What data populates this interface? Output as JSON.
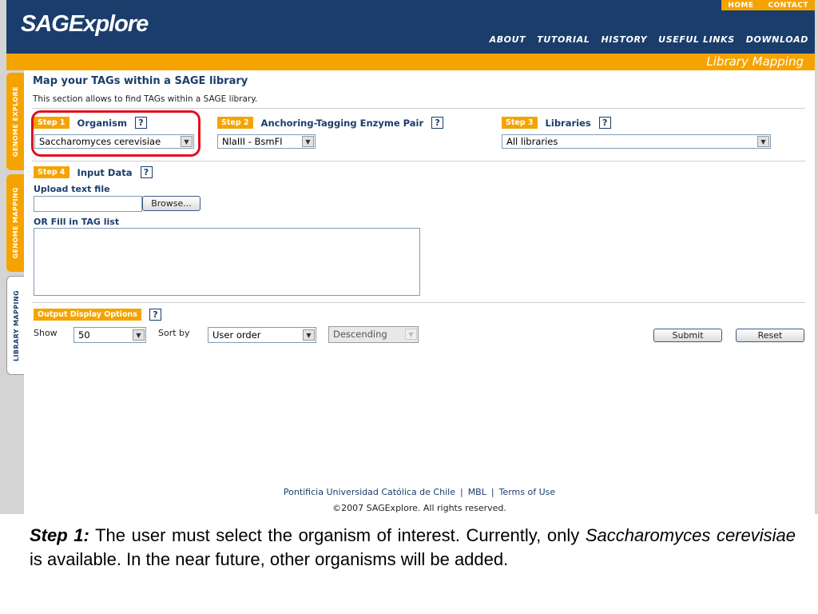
{
  "header": {
    "logo": "SAGExplore",
    "top_links": [
      "HOME",
      "CONTACT"
    ],
    "nav": [
      "ABOUT",
      "TUTORIAL",
      "HISTORY",
      "USEFUL LINKS",
      "DOWNLOAD"
    ],
    "section_title": "Library Mapping"
  },
  "side_tabs": [
    "GENOME EXPLORE",
    "GENOME MAPPING",
    "LIBRARY MAPPING"
  ],
  "main": {
    "title": "Map your TAGs within a SAGE library",
    "description": "This section allows to find TAGs within a SAGE library.",
    "step1": {
      "badge": "Step 1",
      "label": "Organism",
      "selected": "Saccharomyces cerevisiae"
    },
    "step2": {
      "badge": "Step 2",
      "label": "Anchoring-Tagging Enzyme Pair",
      "selected": "NlaIII - BsmFI"
    },
    "step3": {
      "badge": "Step 3",
      "label": "Libraries",
      "selected": "All libraries"
    },
    "step4": {
      "badge": "Step 4",
      "label": "Input Data",
      "upload_label": "Upload text file",
      "browse_label": "Browse...",
      "fill_label": "OR Fill in TAG list"
    },
    "output": {
      "badge": "Output Display Options",
      "show_label": "Show",
      "show_value": "50",
      "sort_label": "Sort by",
      "sort_value": "User order",
      "order_value": "Descending",
      "submit_label": "Submit",
      "reset_label": "Reset"
    },
    "help_glyph": "?",
    "arrow_glyph": "▼"
  },
  "footer": {
    "links": [
      "Pontificia Universidad Católica de Chile",
      "MBL",
      "Terms of Use"
    ],
    "separator": "|",
    "copyright": "©2007 SAGExplore. All rights reserved."
  },
  "caption": {
    "lead": "Step 1:",
    "part1": " The user must select the organism of interest. Currently, only ",
    "species": "Saccharomyces cerevisiae",
    "part2": " is available. In the near future, other organisms will be added."
  },
  "colors": {
    "navy": "#1a3d6b",
    "orange": "#f5a300",
    "highlight": "#e0101c"
  }
}
